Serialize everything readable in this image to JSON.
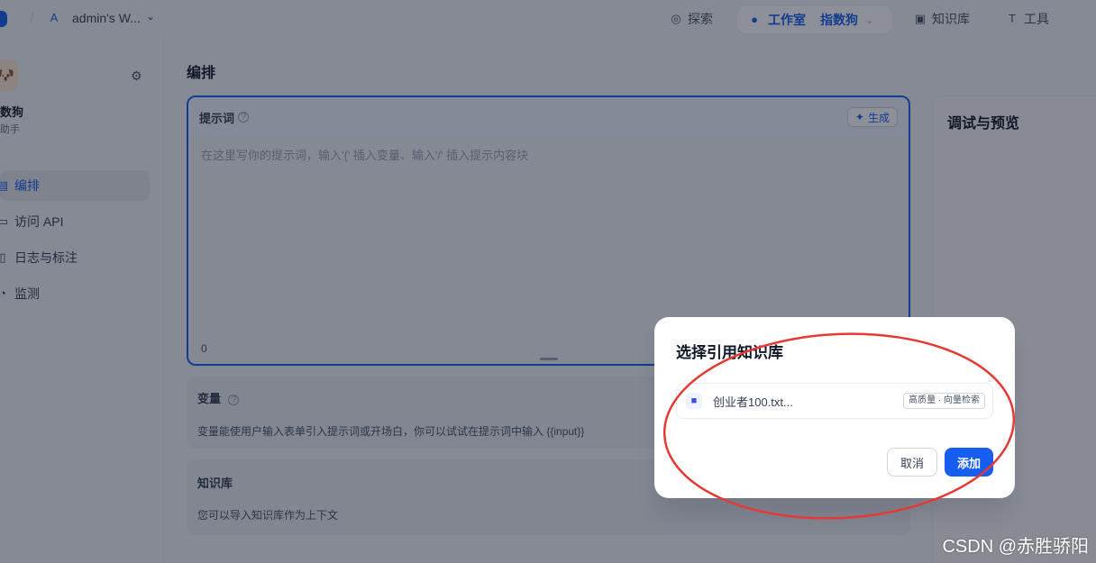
{
  "topbar": {
    "workspace_initial": "A",
    "workspace_name": "admin's W...",
    "nav": {
      "explore": "探索",
      "studio": "工作室",
      "app_name": "指数狗",
      "knowledge": "知识库",
      "tools": "工具"
    }
  },
  "sidebar": {
    "app_name": "数狗",
    "app_type": "助手",
    "items": [
      {
        "label": "编排",
        "icon": "layout-icon",
        "active": true
      },
      {
        "label": "访问 API",
        "icon": "terminal-icon",
        "active": false
      },
      {
        "label": "日志与标注",
        "icon": "file-text-icon",
        "active": false
      },
      {
        "label": "监测",
        "icon": "gauge-icon",
        "active": false
      }
    ]
  },
  "main": {
    "page_title": "编排",
    "prompt": {
      "title": "提示词",
      "generate_label": "生成",
      "placeholder": "在这里写你的提示词，输入'{' 插入变量、输入'/' 插入提示内容块",
      "char_count": "0"
    },
    "variables": {
      "title": "变量",
      "description": "变量能使用户输入表单引入提示词或开场白，你可以试试在提示词中输入 {{input}}"
    },
    "knowledge": {
      "title": "知识库",
      "description": "您可以导入知识库作为上下文"
    },
    "debug": {
      "title": "调试与预览"
    }
  },
  "modal": {
    "title": "选择引用知识库",
    "items": [
      {
        "name": "创业者100.txt...",
        "badge": "高质量 · 向量检索",
        "icon": "folder-icon"
      }
    ],
    "cancel_label": "取消",
    "add_label": "添加"
  },
  "annotation": {
    "color": "#e53935"
  },
  "watermark": "CSDN @赤胜骄阳"
}
